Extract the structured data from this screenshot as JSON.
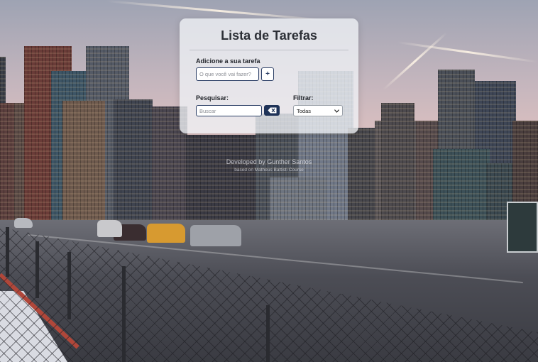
{
  "app": {
    "title": "Lista de Tarefas"
  },
  "add_task": {
    "label": "Adicione a sua tarefa",
    "placeholder": "O que você vai fazer?",
    "add_button_label": "+"
  },
  "search": {
    "label": "Pesquisar:",
    "placeholder": "Buscar",
    "clear_icon": "backspace-icon"
  },
  "filter": {
    "label": "Filtrar:",
    "selected": "Todas",
    "dropdown_icon": "chevron-down-icon"
  },
  "footer": {
    "developed_by": "Developed by Gunther Santos",
    "based_on": "based on Matheus Battisti Course"
  },
  "colors": {
    "accent": "#1f3358",
    "card_bg": "#f0f2f6",
    "title": "#2c2f36"
  }
}
